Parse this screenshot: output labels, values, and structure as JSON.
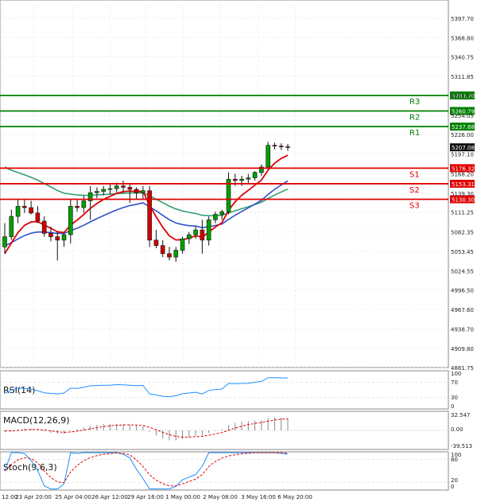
{
  "colors": {
    "resistance": "#008000",
    "support": "#e00000",
    "candle_up": "#00a000",
    "candle_down": "#d00000",
    "ema_fast": "#e00000",
    "ema_mid": "#3050d0",
    "ema_slow": "#30a070",
    "osc_blue": "#1e90ff",
    "osc_red": "#e00000",
    "grid": "#d8d8d8"
  },
  "chart_data": {
    "type": "candlestick",
    "price_axis": {
      "ticks": [
        "5397.70",
        "5368.80",
        "5340.75",
        "5311.85",
        "5283.70",
        "5254.05",
        "5226.00",
        "5197.10",
        "5168.20",
        "5139.30",
        "5111.25",
        "5082.35",
        "5053.45",
        "5024.55",
        "4996.50",
        "4967.60",
        "4938.70",
        "4909.80",
        "4881.75"
      ],
      "range": [
        4881.75,
        5420
      ]
    },
    "time_axis": {
      "ticks": [
        "12:00",
        "23 Apr 20:00",
        "25 Apr 04:00",
        "26 Apr 12:00",
        "29 Apr 16:00",
        "1 May 00:00",
        "2 May 08:00",
        "3 May 16:00",
        "6 May 20:00"
      ]
    },
    "levels": [
      {
        "name": "R3",
        "price": "5283.70",
        "value": 5283.7,
        "kind": "resistance"
      },
      {
        "name": "R2",
        "price": "5260.79",
        "value": 5260.79,
        "kind": "resistance"
      },
      {
        "name": "R1",
        "price": "5237.68",
        "value": 5237.68,
        "kind": "resistance"
      },
      {
        "name": "S1",
        "price": "5176.32",
        "value": 5176.32,
        "kind": "support"
      },
      {
        "name": "S2",
        "price": "5153.31",
        "value": 5153.31,
        "kind": "support"
      },
      {
        "name": "S3",
        "price": "5130.30",
        "value": 5130.3,
        "kind": "support"
      }
    ],
    "last_price": {
      "label": "5207.08",
      "value": 5207.08
    },
    "candles": [
      [
        5060,
        5095,
        5050,
        5075
      ],
      [
        5075,
        5115,
        5070,
        5105
      ],
      [
        5105,
        5130,
        5095,
        5120
      ],
      [
        5120,
        5130,
        5110,
        5118
      ],
      [
        5118,
        5128,
        5108,
        5110
      ],
      [
        5110,
        5120,
        5095,
        5098
      ],
      [
        5098,
        5105,
        5075,
        5080
      ],
      [
        5080,
        5090,
        5068,
        5075
      ],
      [
        5075,
        5082,
        5040,
        5070
      ],
      [
        5070,
        5080,
        5060,
        5078
      ],
      [
        5078,
        5130,
        5065,
        5120
      ],
      [
        5120,
        5130,
        5112,
        5118
      ],
      [
        5118,
        5135,
        5110,
        5128
      ],
      [
        5128,
        5150,
        5100,
        5140
      ],
      [
        5140,
        5148,
        5132,
        5142
      ],
      [
        5142,
        5150,
        5136,
        5145
      ],
      [
        5145,
        5152,
        5138,
        5146
      ],
      [
        5146,
        5155,
        5140,
        5150
      ],
      [
        5150,
        5158,
        5140,
        5148
      ],
      [
        5148,
        5152,
        5125,
        5145
      ],
      [
        5145,
        5148,
        5130,
        5140
      ],
      [
        5140,
        5150,
        5130,
        5143
      ],
      [
        5143,
        5150,
        5060,
        5070
      ],
      [
        5070,
        5085,
        5058,
        5062
      ],
      [
        5062,
        5070,
        5045,
        5050
      ],
      [
        5050,
        5060,
        5040,
        5045
      ],
      [
        5045,
        5060,
        5038,
        5055
      ],
      [
        5055,
        5075,
        5050,
        5072
      ],
      [
        5072,
        5082,
        5064,
        5078
      ],
      [
        5078,
        5090,
        5072,
        5085
      ],
      [
        5085,
        5100,
        5050,
        5070
      ],
      [
        5070,
        5105,
        5062,
        5100
      ],
      [
        5100,
        5112,
        5095,
        5108
      ],
      [
        5108,
        5115,
        5100,
        5112
      ],
      [
        5112,
        5170,
        5108,
        5160
      ],
      [
        5160,
        5168,
        5150,
        5158
      ],
      [
        5158,
        5165,
        5150,
        5160
      ],
      [
        5160,
        5168,
        5154,
        5162
      ],
      [
        5162,
        5172,
        5158,
        5170
      ],
      [
        5170,
        5182,
        5165,
        5178
      ],
      [
        5178,
        5215,
        5175,
        5210
      ],
      [
        5210,
        5214,
        5204,
        5209
      ],
      [
        5209,
        5213,
        5203,
        5208
      ],
      [
        5208,
        5212,
        5202,
        5207
      ]
    ],
    "indicators": [
      {
        "name": "RSI(14)",
        "ticks": [
          "100",
          "70",
          "30",
          "0"
        ]
      },
      {
        "name": "MACD(12,26,9)",
        "ticks": [
          "32.547",
          "0.00",
          "-39.513"
        ]
      },
      {
        "name": "Stoch(9,6,3)",
        "ticks": [
          "100",
          "80",
          "20",
          "0"
        ]
      }
    ]
  }
}
